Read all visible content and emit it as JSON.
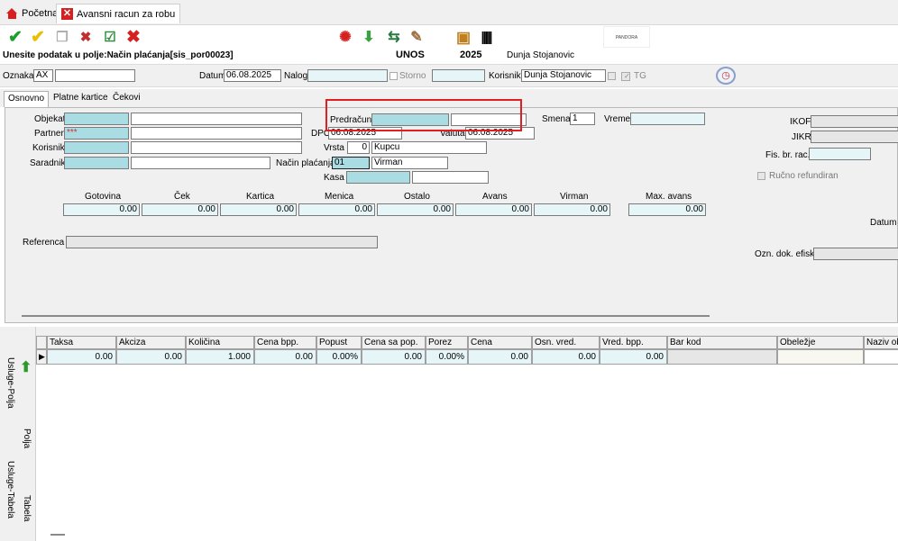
{
  "tabs": {
    "home": "Početna",
    "active": "Avansni racun za robu"
  },
  "status": {
    "message": "Unesite podatak u polje:Način plaćanja[sis_por00023]",
    "mode": "UNOS",
    "year": "2025",
    "user": "Dunja Stojanovic",
    "logo_text": "PANDORA"
  },
  "header": {
    "oznaka_label": "Oznaka",
    "oznaka_value": "AX",
    "datum_label": "Datum",
    "datum_value": "06.08.2025",
    "nalog_label": "Nalog",
    "storno_label": "Storno",
    "korisnik_label": "Korisnik",
    "korisnik_value": "Dunja Stojanovic",
    "tg_label": "TG"
  },
  "subtabs": [
    "Osnovno",
    "Platne kartice",
    "Čekovi"
  ],
  "form": {
    "objekat_label": "Objekat",
    "partner_label": "Partner",
    "partner_value": "***",
    "korisnik_label": "Korisnik",
    "saradnik_label": "Saradnik",
    "predracun_label": "Predračun",
    "dpo_label": "DPO",
    "dpo_value": "06.08.2025",
    "valuta_label": "Valuta",
    "valuta_value": "06.08.2025",
    "vrsta_label": "Vrsta",
    "vrsta_code": "0",
    "vrsta_name": "Kupcu",
    "nacin_label": "Način plaćanja",
    "nacin_code": "01",
    "nacin_name": "Virman",
    "kasa_label": "Kasa",
    "smena_label": "Smena",
    "smena_value": "1",
    "vreme_label": "Vreme",
    "ikof_label": "IKOF",
    "jikr_label": "JIKR",
    "fis_label": "Fis. br. rac.",
    "rucno_label": "Ručno refundiran",
    "datum_u_label": "Datum u",
    "ozn_label": "Ozn. dok. efisk",
    "referenca_label": "Referenca"
  },
  "payments": [
    {
      "label": "Gotovina",
      "value": "0.00"
    },
    {
      "label": "Ček",
      "value": "0.00"
    },
    {
      "label": "Kartica",
      "value": "0.00"
    },
    {
      "label": "Menica",
      "value": "0.00"
    },
    {
      "label": "Ostalo",
      "value": "0.00"
    },
    {
      "label": "Avans",
      "value": "0.00"
    },
    {
      "label": "Virman",
      "value": "0.00"
    },
    {
      "label": "Max. avans",
      "value": "0.00"
    }
  ],
  "side_tabs": [
    "Usluge-Polja",
    "Polja",
    "Usluge-Tabela",
    "Tabela"
  ],
  "grid": {
    "columns": [
      "Taksa",
      "Akciza",
      "Količina",
      "Cena bpp.",
      "Popust",
      "Cena sa pop.",
      "Porez",
      "Cena",
      "Osn. vred.",
      "Vred. bpp.",
      "Bar kod",
      "Obeležje",
      "Naziv ob"
    ],
    "row": [
      "0.00",
      "0.00",
      "1.000",
      "0.00",
      "0.00%",
      "0.00",
      "0.00%",
      "0.00",
      "0.00",
      "0.00",
      "",
      "",
      ""
    ]
  },
  "colors": {
    "field_cyan": "#a9dde3",
    "field_light": "#e6f5f7",
    "highlight_red": "#e02020",
    "check_green": "#1e9e2a",
    "check_yellow": "#e8c000"
  }
}
